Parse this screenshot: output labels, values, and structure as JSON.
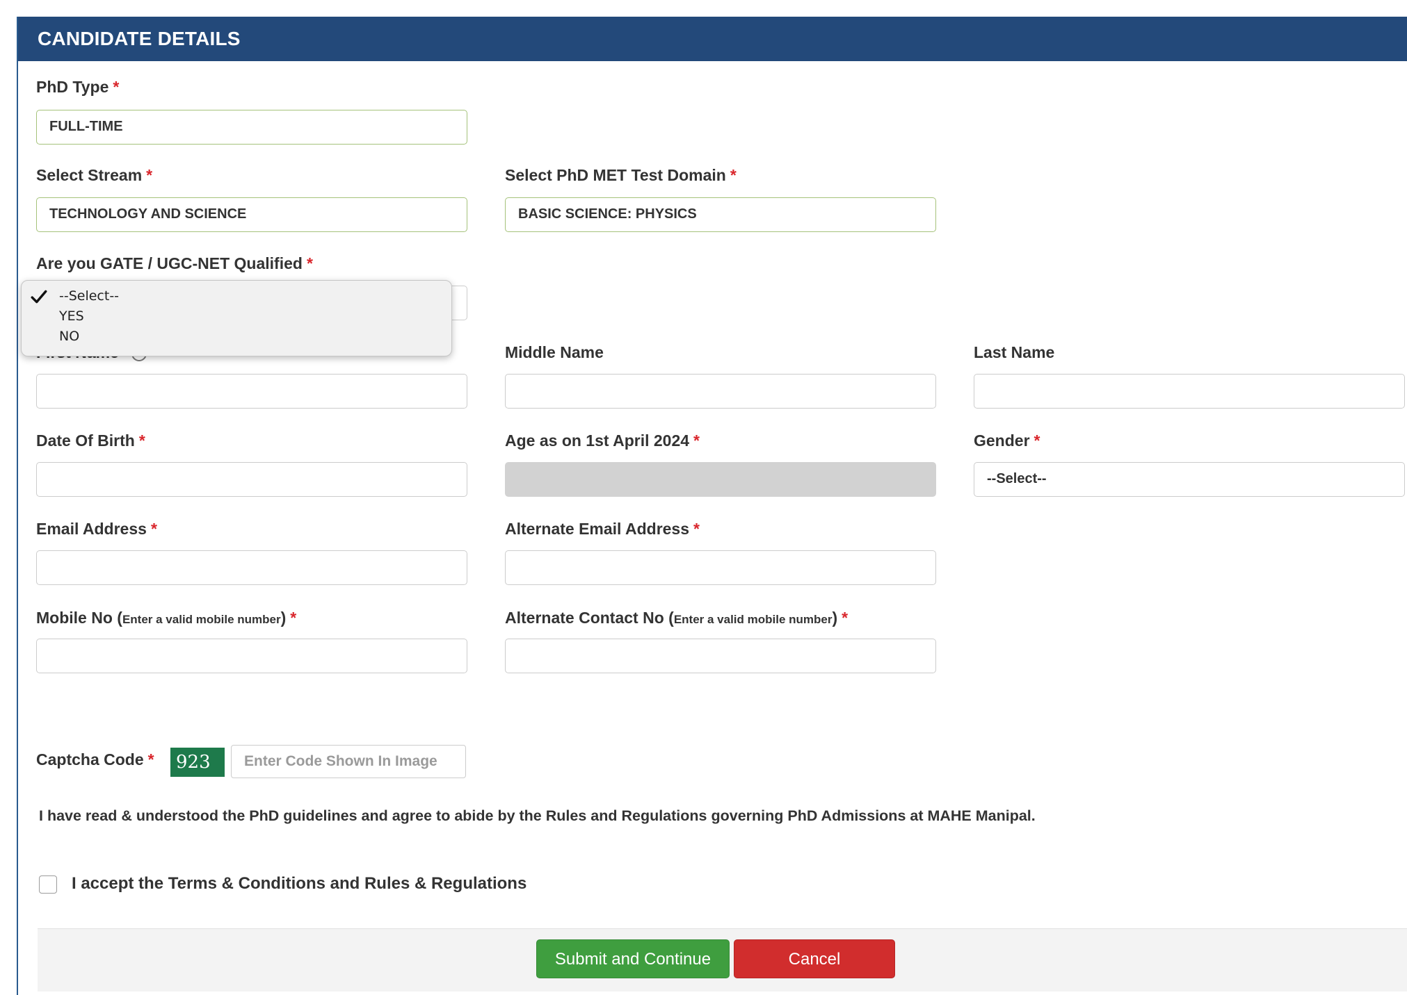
{
  "header": {
    "title": "CANDIDATE DETAILS"
  },
  "required_marker": "*",
  "phd_type": {
    "label": "PhD Type",
    "value": "FULL-TIME"
  },
  "stream": {
    "label": "Select Stream",
    "value": "TECHNOLOGY AND SCIENCE"
  },
  "test_domain": {
    "label": "Select PhD MET Test Domain",
    "value": "BASIC SCIENCE: PHYSICS"
  },
  "gate": {
    "label": "Are you GATE / UGC-NET Qualified",
    "options": [
      "--Select--",
      "YES",
      "NO"
    ],
    "selected": "--Select--"
  },
  "first_name": {
    "label": "First Name",
    "info_icon": "info-icon",
    "value": ""
  },
  "middle_name": {
    "label": "Middle Name",
    "value": ""
  },
  "last_name": {
    "label": "Last Name",
    "value": ""
  },
  "dob": {
    "label": "Date Of Birth",
    "value": ""
  },
  "age": {
    "label": "Age as on 1st April 2024",
    "value": ""
  },
  "gender": {
    "label": "Gender",
    "value": "--Select--"
  },
  "email": {
    "label": "Email Address",
    "value": ""
  },
  "alt_email": {
    "label": "Alternate Email Address",
    "value": ""
  },
  "mobile": {
    "label": "Mobile No",
    "hint": "Enter a valid mobile number",
    "value": ""
  },
  "alt_contact": {
    "label": "Alternate Contact No",
    "hint": "Enter a valid mobile number",
    "value": ""
  },
  "captcha": {
    "label": "Captcha Code",
    "code": "923",
    "placeholder": "Enter Code Shown In Image"
  },
  "guidelines_note": "I have read & understood the PhD guidelines and agree to abide by the Rules and Regulations governing PhD Admissions at MAHE Manipal.",
  "terms": {
    "label": "I accept the Terms & Conditions and Rules & Regulations",
    "checked": false
  },
  "buttons": {
    "submit": "Submit and Continue",
    "cancel": "Cancel"
  },
  "colors": {
    "header_bg": "#23497a",
    "required": "#d9262c",
    "submit": "#3f9e3f",
    "cancel": "#d12d2d",
    "captcha_bg": "#1e7a4b"
  }
}
